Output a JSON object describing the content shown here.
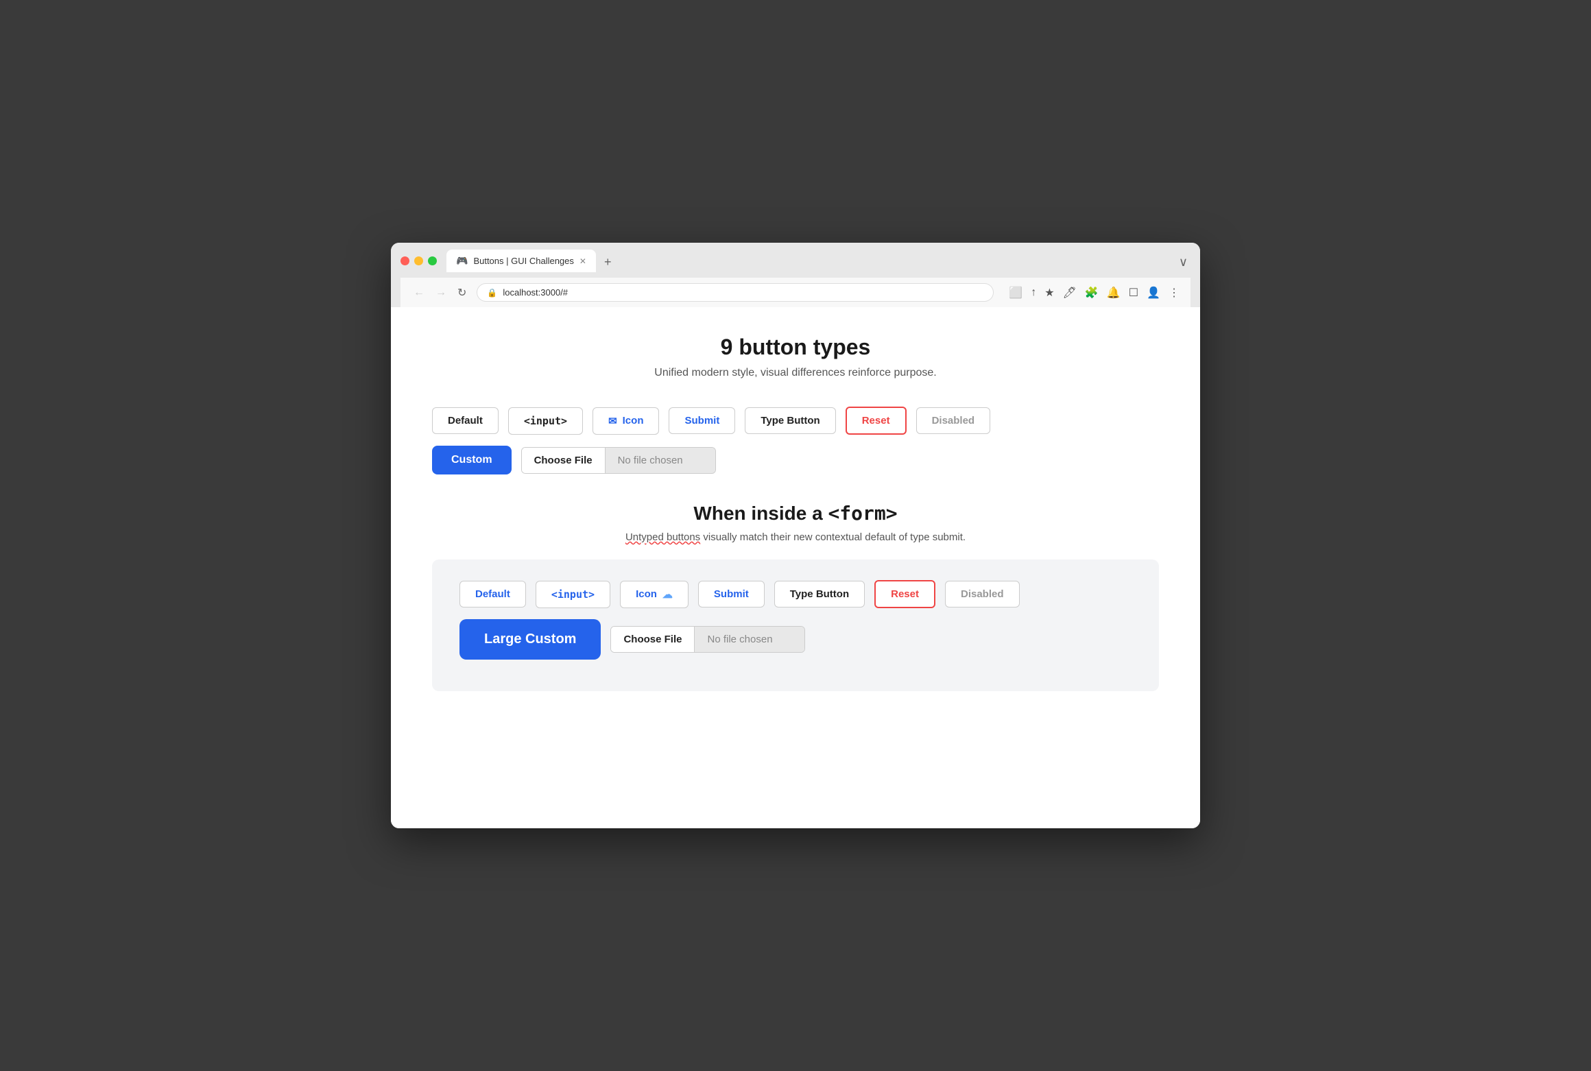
{
  "browser": {
    "traffic_lights": [
      "red",
      "yellow",
      "green"
    ],
    "tab": {
      "icon": "🎮",
      "label": "Buttons | GUI Challenges",
      "close": "✕"
    },
    "new_tab": "+",
    "tab_end": "∨",
    "nav": {
      "back": "←",
      "forward": "→",
      "reload": "↻"
    },
    "url": "localhost:3000/#",
    "actions": [
      "⬜",
      "↑",
      "★",
      "🖍",
      "🧩",
      "🔔",
      "☐",
      "👤",
      "⋮"
    ]
  },
  "page": {
    "title": "9 button types",
    "subtitle": "Unified modern style, visual differences reinforce purpose.",
    "buttons_row1": [
      {
        "label": "Default",
        "type": "default"
      },
      {
        "label": "<input>",
        "type": "input"
      },
      {
        "label": "Icon",
        "type": "icon"
      },
      {
        "label": "Submit",
        "type": "submit"
      },
      {
        "label": "Type Button",
        "type": "type"
      },
      {
        "label": "Reset",
        "type": "reset"
      },
      {
        "label": "Disabled",
        "type": "disabled"
      }
    ],
    "custom_button": "Custom",
    "file_button": "Choose File",
    "file_text": "No file chosen",
    "form_section": {
      "heading": "When inside a",
      "heading_code": "<form>",
      "subtitle_before": "Untyped buttons",
      "subtitle_after": " visually match their new contextual default of type submit.",
      "buttons": [
        {
          "label": "Default",
          "type": "form-default"
        },
        {
          "label": "<input>",
          "type": "form-input"
        },
        {
          "label": "Icon",
          "type": "form-icon"
        },
        {
          "label": "Submit",
          "type": "submit"
        },
        {
          "label": "Type Button",
          "type": "type"
        },
        {
          "label": "Reset",
          "type": "reset"
        },
        {
          "label": "Disabled",
          "type": "disabled"
        }
      ],
      "large_custom_button": "Large Custom",
      "file_button": "Choose File",
      "file_text": "No file chosen"
    }
  }
}
